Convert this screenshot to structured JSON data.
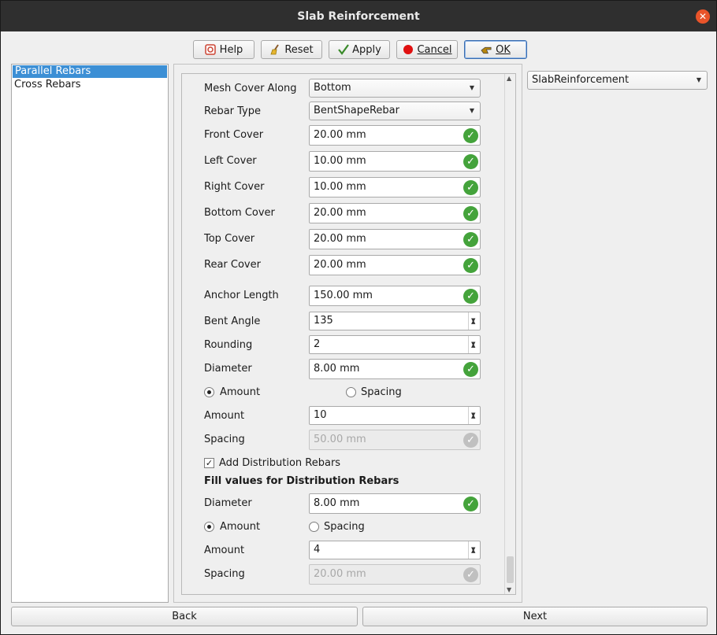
{
  "window": {
    "title": "Slab Reinforcement"
  },
  "toolbar": {
    "help": "Help",
    "reset": "Reset",
    "apply": "Apply",
    "cancel": "Cancel",
    "ok": "OK"
  },
  "sidebar": {
    "items": [
      {
        "label": "Parallel Rebars",
        "selected": true
      },
      {
        "label": "Cross Rebars",
        "selected": false
      }
    ]
  },
  "form": {
    "mesh_cover_along": {
      "label": "Mesh Cover Along",
      "value": "Bottom"
    },
    "rebar_type": {
      "label": "Rebar Type",
      "value": "BentShapeRebar"
    },
    "front_cover": {
      "label": "Front Cover",
      "value": "20.00 mm"
    },
    "left_cover": {
      "label": "Left Cover",
      "value": "10.00 mm"
    },
    "right_cover": {
      "label": "Right Cover",
      "value": "10.00 mm"
    },
    "bottom_cover": {
      "label": "Bottom Cover",
      "value": "20.00 mm"
    },
    "top_cover": {
      "label": "Top Cover",
      "value": "20.00 mm"
    },
    "rear_cover": {
      "label": "Rear Cover",
      "value": "20.00 mm"
    },
    "anchor_length": {
      "label": "Anchor Length",
      "value": "150.00 mm"
    },
    "bent_angle": {
      "label": "Bent Angle",
      "value": "135"
    },
    "rounding": {
      "label": "Rounding",
      "value": "2"
    },
    "diameter": {
      "label": "Diameter",
      "value": "8.00 mm"
    },
    "mode_amount": {
      "label": "Amount",
      "checked": true
    },
    "mode_spacing": {
      "label": "Spacing",
      "checked": false
    },
    "amount": {
      "label": "Amount",
      "value": "10"
    },
    "spacing": {
      "label": "Spacing",
      "value": "50.00 mm"
    },
    "add_distribution": {
      "label": "Add Distribution Rebars",
      "checked": true
    },
    "distribution_title": "Fill values for Distribution Rebars",
    "dist_diameter": {
      "label": "Diameter",
      "value": "8.00 mm"
    },
    "dist_mode_amount": {
      "label": "Amount",
      "checked": true
    },
    "dist_mode_spacing": {
      "label": "Spacing",
      "checked": false
    },
    "dist_amount": {
      "label": "Amount",
      "value": "4"
    },
    "dist_spacing": {
      "label": "Spacing",
      "value": "20.00 mm"
    }
  },
  "object_select": {
    "value": "SlabReinforcement"
  },
  "footer": {
    "back": "Back",
    "next": "Next"
  }
}
